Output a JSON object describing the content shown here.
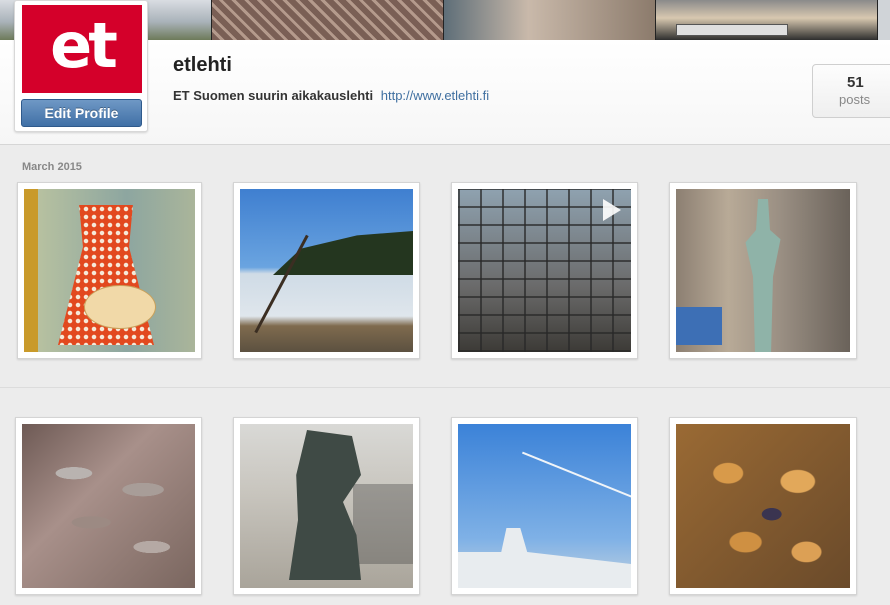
{
  "profile": {
    "username": "etlehti",
    "avatar_text": "et",
    "edit_profile_label": "Edit Profile",
    "bio_text": "ET Suomen suurin aikakauslehti",
    "bio_link": "http://www.etlehti.fi",
    "posts_count": "51",
    "posts_label": "posts"
  },
  "feed": {
    "month_label": "March 2015",
    "photos": [
      {
        "name": "photo-dress-book",
        "icon": "image"
      },
      {
        "name": "photo-frozen-lake",
        "icon": "image"
      },
      {
        "name": "photo-glass-dome",
        "icon": "video-play-icon"
      },
      {
        "name": "photo-statue",
        "icon": "image"
      },
      {
        "name": "photo-fish",
        "icon": "image"
      },
      {
        "name": "photo-bust",
        "icon": "image"
      },
      {
        "name": "photo-ship",
        "icon": "image"
      },
      {
        "name": "photo-pastries",
        "icon": "image"
      }
    ]
  },
  "colors": {
    "brand_red": "#d4002a",
    "button_blue": "#4d7db0",
    "link_blue": "#3f6fa0"
  }
}
